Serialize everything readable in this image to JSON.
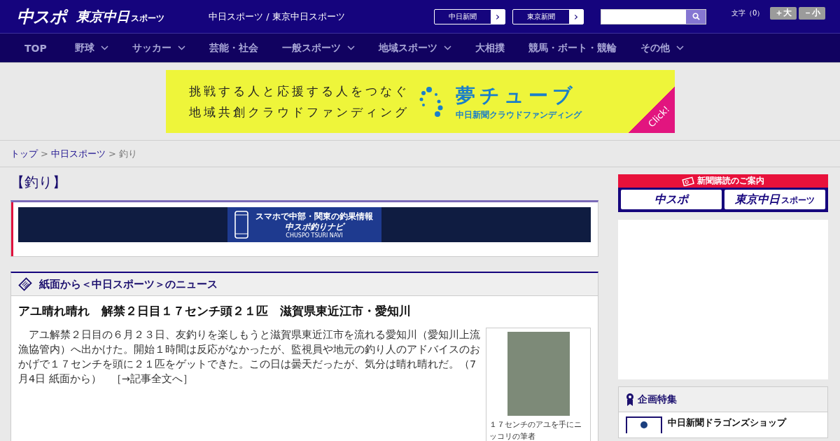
{
  "header": {
    "logo_main": "中スポ",
    "logo_sub": "東京中日",
    "logo_sub_small": "スポーツ",
    "site_title": "中日スポーツ / 東京中日スポーツ",
    "paper_links": [
      {
        "label": "中日新聞",
        "arrow": "›"
      },
      {
        "label": "東京新聞",
        "arrow": "›"
      }
    ],
    "font_size": {
      "label": "文字（0）",
      "buttons": [
        "＋大",
        "－小"
      ]
    }
  },
  "nav": [
    {
      "label": "TOP",
      "dropdown": false
    },
    {
      "label": "野球",
      "dropdown": true
    },
    {
      "label": "サッカー",
      "dropdown": true
    },
    {
      "label": "芸能・社会",
      "dropdown": false
    },
    {
      "label": "一般スポーツ",
      "dropdown": true
    },
    {
      "label": "地域スポーツ",
      "dropdown": true
    },
    {
      "label": "大相撲",
      "dropdown": false
    },
    {
      "label": "競馬・ボート・競輪",
      "dropdown": false
    },
    {
      "label": "その他",
      "dropdown": true
    }
  ],
  "ad_banner": {
    "line1": "挑戦する人と応援する人をつなぐ",
    "line2": "地域共創クラウドファンディング",
    "brand": "夢チューブ",
    "brand_sub": "中日新聞クラウドファンディング",
    "corner": "Click!"
  },
  "breadcrumb": [
    {
      "label": "トップ",
      "link": true
    },
    {
      "label": "中日スポーツ",
      "link": true
    },
    {
      "label": "釣り",
      "link": false
    }
  ],
  "breadcrumb_separator": ">",
  "section_title": "【釣り】",
  "navi_banner": {
    "line1": "スマホで中部・関東の釣果情報",
    "line2": "中スポ釣りナビ",
    "line3": "CHUSPO TSURI NAVI"
  },
  "news": {
    "heading": "紙面から＜中日スポーツ＞のニュース",
    "article": {
      "title": "アユ晴れ晴れ　解禁２日目１７センチ頭２１匹　滋賀県東近江市・愛知川",
      "body": "　アユ解禁２日目の６月２３日、友釣りを楽しもうと滋賀県東近江市を流れる愛知川（愛知川上流漁協管内）へ出かけた。開始１時間は反応がなかったが、監視員や地元の釣り人のアドバイスのおかげで１７センチを頭に２１匹をゲットできた。この日は曇天だったが、気分は晴れ晴れだ。（7月4日 紙面から）",
      "more": "［→記事全文へ］",
      "caption": "１７センチのアユを手にニッコリの筆者"
    }
  },
  "sidebar": {
    "subscribe": {
      "title": "新聞購読のご案内",
      "buttons": [
        "中スポ",
        "東京中日"
      ],
      "button_small": "スポーツ"
    },
    "feature": {
      "title": "企画特集",
      "items": [
        "中日新聞ドラゴンズショップ"
      ]
    }
  }
}
